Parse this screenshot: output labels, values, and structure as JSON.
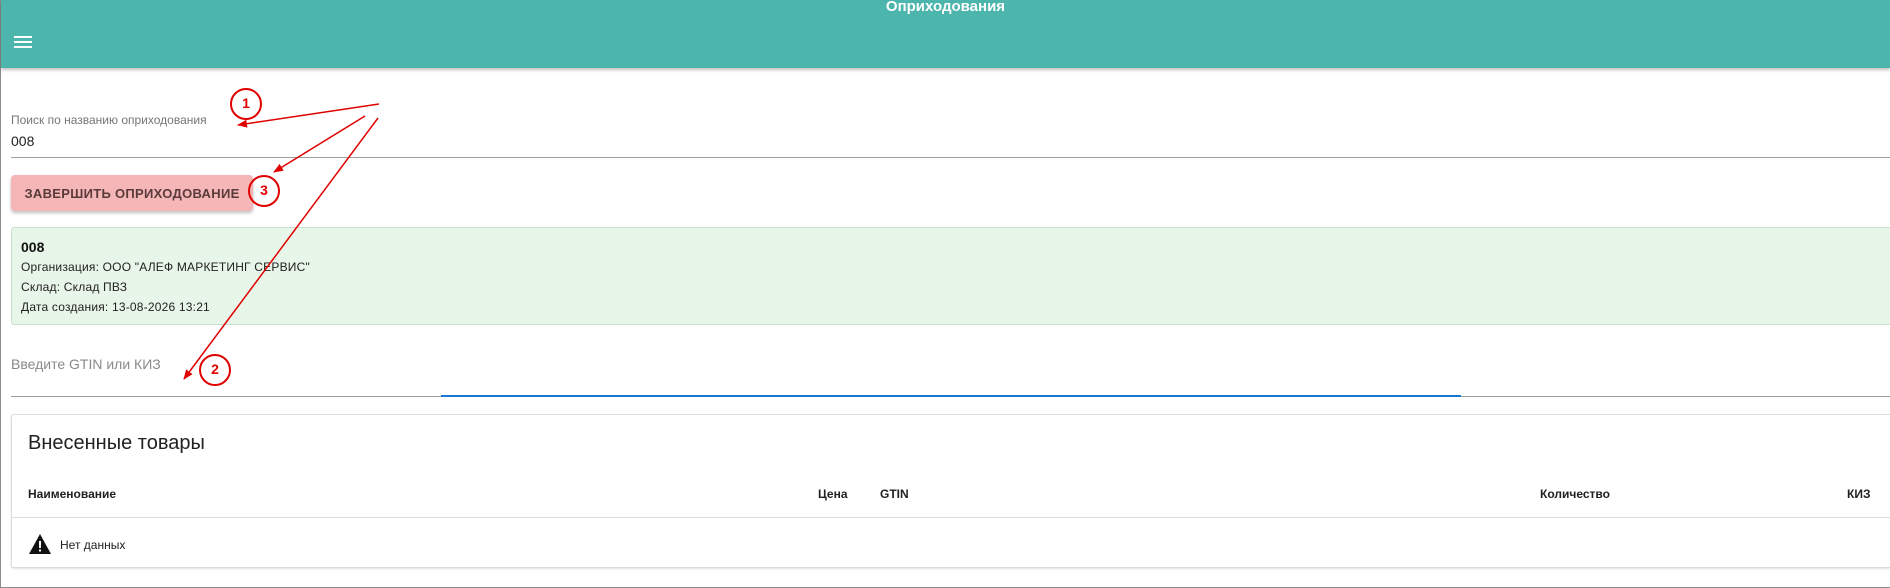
{
  "appbar": {
    "title": "Оприходования",
    "color": "#4db6ac",
    "menu_icon": "menu-icon"
  },
  "search": {
    "label": "Поиск по названию оприходования",
    "value": "008"
  },
  "actions": {
    "finish_label": "ЗАВЕРШИТЬ ОПРИХОДОВАНИЕ",
    "finish_color": "#f4b6b6"
  },
  "document": {
    "number": "008",
    "organization": "Организация: ООО \"АЛЕФ МАРКЕТИНГ СЕРВИС\"",
    "warehouse": "Склад: Склад ПВЗ",
    "created": "Дата создания: 13-08-2026 13:21",
    "background": "#e8f5e9"
  },
  "gtin": {
    "placeholder": "Введите GTIN или КИЗ",
    "value": "",
    "focus_color": "#1976d2"
  },
  "items": {
    "title": "Внесенные товары",
    "columns": [
      "Наименование",
      "Цена",
      "GTIN",
      "Количество",
      "КИЗ"
    ],
    "rows": [],
    "empty_text": "Нет данных",
    "empty_icon": "warning-icon"
  },
  "annotations": {
    "color": "#e00000",
    "markers": [
      "1",
      "2",
      "3"
    ]
  }
}
